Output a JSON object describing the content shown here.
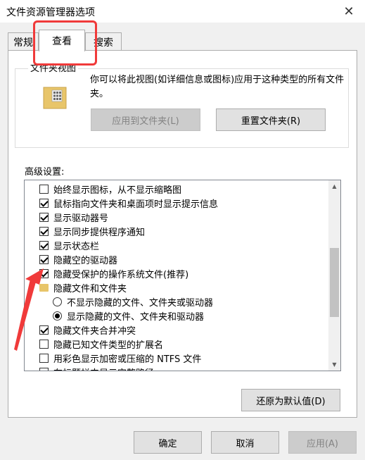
{
  "window": {
    "title": "文件资源管理器选项",
    "close_glyph": "✕"
  },
  "tabs": [
    {
      "label": "常规",
      "active": false
    },
    {
      "label": "查看",
      "active": true
    },
    {
      "label": "搜索",
      "active": false
    }
  ],
  "folder_view": {
    "legend": "文件夹视图",
    "description": "你可以将此视图(如详细信息或图标)应用于这种类型的所有文件夹。",
    "apply_button": "应用到文件夹(L)",
    "reset_button": "重置文件夹(R)"
  },
  "advanced": {
    "label": "高级设置:",
    "items": [
      {
        "kind": "checkbox",
        "checked": false,
        "label": "始终显示图标，从不显示缩略图"
      },
      {
        "kind": "checkbox",
        "checked": true,
        "label": "鼠标指向文件夹和桌面项时显示提示信息"
      },
      {
        "kind": "checkbox",
        "checked": true,
        "label": "显示驱动器号"
      },
      {
        "kind": "checkbox",
        "checked": true,
        "label": "显示同步提供程序通知"
      },
      {
        "kind": "checkbox",
        "checked": true,
        "label": "显示状态栏"
      },
      {
        "kind": "checkbox",
        "checked": true,
        "label": "隐藏空的驱动器"
      },
      {
        "kind": "checkbox",
        "checked": true,
        "label": "隐藏受保护的操作系统文件(推荐)"
      },
      {
        "kind": "folder",
        "label": "隐藏文件和文件夹"
      },
      {
        "kind": "radio",
        "selected": false,
        "label": "不显示隐藏的文件、文件夹或驱动器"
      },
      {
        "kind": "radio",
        "selected": true,
        "label": "显示隐藏的文件、文件夹和驱动器"
      },
      {
        "kind": "checkbox",
        "checked": true,
        "label": "隐藏文件夹合并冲突"
      },
      {
        "kind": "checkbox",
        "checked": false,
        "label": "隐藏已知文件类型的扩展名"
      },
      {
        "kind": "checkbox",
        "checked": false,
        "label": "用彩色显示加密或压缩的 NTFS 文件"
      },
      {
        "kind": "checkbox",
        "checked": false,
        "label": "在标题栏中显示完整路径"
      }
    ],
    "restore_button": "还原为默认值(D)"
  },
  "footer": {
    "ok": "确定",
    "cancel": "取消",
    "apply": "应用(A)"
  },
  "annotation_color": "#f03a3a"
}
